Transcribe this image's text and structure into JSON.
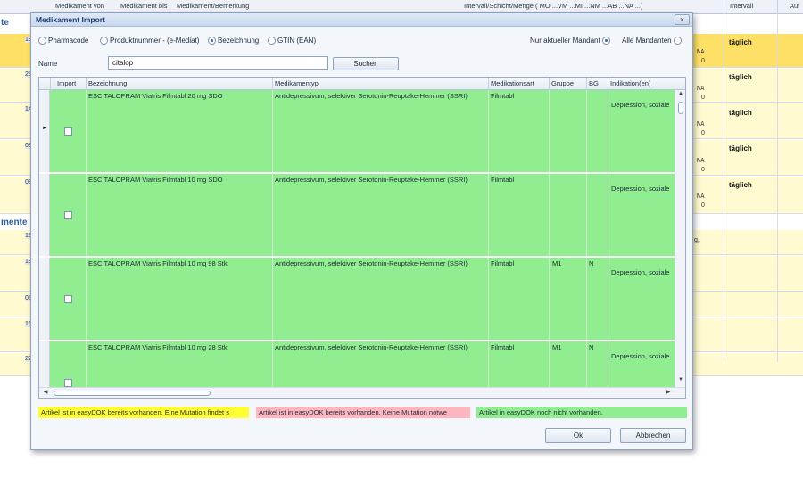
{
  "background": {
    "columns": [
      "Medikament von",
      "Medikament bis",
      "Medikament/Bemerkung",
      "Intervall/Schicht/Menge ( MO ...VM ...MI ...NM ...AB ...NA ...)",
      "Intervall",
      "Auf"
    ],
    "section_labels": [
      "te",
      "mente"
    ],
    "row_ids": [
      "19",
      "29",
      "14",
      "08",
      "08",
      "19",
      "19",
      "05",
      "16",
      "22"
    ],
    "na_label": "NA",
    "zero_label": "0",
    "interval_label": "täglich",
    "row_fragment": "g,"
  },
  "dialog": {
    "title": "Medikament Import",
    "close_glyph": "×",
    "search_options": [
      {
        "label": "Pharmacode",
        "checked": false
      },
      {
        "label": "Produktnummer - (e-Mediat)",
        "checked": false
      },
      {
        "label": "Bezeichnung",
        "checked": true
      },
      {
        "label": "GTIN (EAN)",
        "checked": false
      }
    ],
    "mandant_options": [
      {
        "label": "Nur aktueller Mandant",
        "checked": true
      },
      {
        "label": "Alle Mandanten",
        "checked": false
      }
    ],
    "name_label": "Name",
    "name_value": "citalop",
    "search_button": "Suchen",
    "grid": {
      "columns": [
        "Import",
        "Bezeichnung",
        "Medikamentyp",
        "Medikationsart",
        "Gruppe",
        "BG",
        "Indikation(en)"
      ],
      "rows": [
        {
          "bezeichnung": "ESCITALOPRAM Viatris Filmtabl 20 mg SDO",
          "typ": "Antidepressivum, selektiver Serotonin-Reuptake-Hemmer (SSRI)",
          "art": "Filmtabl",
          "gruppe": "",
          "bg": "",
          "indikation": "Depression, soziale",
          "checked": false,
          "current": true
        },
        {
          "bezeichnung": "ESCITALOPRAM Viatris Filmtabl 10 mg SDO",
          "typ": "Antidepressivum, selektiver Serotonin-Reuptake-Hemmer (SSRI)",
          "art": "Filmtabl",
          "gruppe": "",
          "bg": "",
          "indikation": "Depression, soziale",
          "checked": false,
          "current": false
        },
        {
          "bezeichnung": "ESCITALOPRAM Viatris Filmtabl 10 mg 98 Stk",
          "typ": "Antidepressivum, selektiver Serotonin-Reuptake-Hemmer (SSRI)",
          "art": "Filmtabl",
          "gruppe": "M1",
          "bg": "N",
          "indikation": "Depression, soziale",
          "checked": false,
          "current": false
        },
        {
          "bezeichnung": "ESCITALOPRAM Viatris Filmtabl 10 mg 28 Stk",
          "typ": "Antidepressivum, selektiver Serotonin-Reuptake-Hemmer (SSRI)",
          "art": "Filmtabl",
          "gruppe": "M1",
          "bg": "N",
          "indikation": "Depression, soziale",
          "checked": false,
          "current": false
        }
      ]
    },
    "legend": {
      "yellow": "Artikel ist in easyDOK bereits vorhanden. Eine Mutation findet s",
      "pink": "Artikel ist in easyDOK bereits vorhanden. Keine Mutation notwe",
      "green": "Artikel in easyDOK noch nicht vorhanden."
    },
    "ok_button": "Ok",
    "cancel_button": "Abbrechen"
  },
  "colors": {
    "row_green": "#90ee90",
    "legend_yellow": "#ffff33",
    "legend_pink": "#ffb6c1",
    "bg_orange": "#ffe066",
    "bg_pale": "#fffad0",
    "accent": "#2f63b8"
  },
  "icons": [
    "close-icon",
    "row-pointer-icon",
    "scroll-up-icon",
    "scroll-down-icon",
    "scroll-left-icon",
    "scroll-right-icon"
  ]
}
